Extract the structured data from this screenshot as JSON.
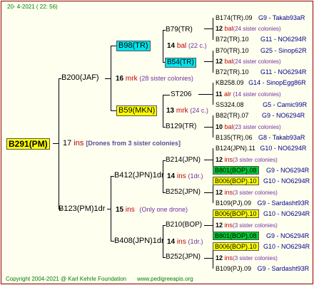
{
  "header": {
    "date": "20-  4-2021 ( 22: 56)"
  },
  "root": {
    "name": "B291(PM)",
    "num": "17",
    "mark": "ins",
    "note": "[Drones from 3 sister colonies]"
  },
  "gen1": {
    "top": {
      "name": "B200(JAF)",
      "num": "16",
      "mark": "mrk",
      "note": "(28 sister colonies)"
    },
    "bottom": {
      "name": "B123(PM)1dr",
      "num": "15",
      "mark": "ins",
      "note": "(Only one drone)"
    }
  },
  "gen2": {
    "a": {
      "name": "B98(TR)",
      "num": "14",
      "mark": "bal",
      "note": "(22 c.)"
    },
    "b": {
      "name": "B59(MKN)",
      "num": "13",
      "mark": "mrk",
      "note": "(24 c.)"
    },
    "c": {
      "name": "B412(JPN)1dr",
      "num": "14",
      "mark": "ins",
      "note": "(1dr.)"
    },
    "d": {
      "name": "B408(JPN)1dr",
      "num": "14",
      "mark": "ins",
      "note": "(1dr.)"
    }
  },
  "gen3": {
    "a1": "B79(TR)",
    "a2": "B54(TR)",
    "b1": "ST206",
    "b2": "B129(TR)",
    "c1": "B214(JPN)",
    "c2": "B252(JPN)",
    "d1": "B210(BOP)",
    "d2": "B252(JPN)"
  },
  "gen4": {
    "r1": {
      "name": "B174(TR).09",
      "code": "G9 - Takab93aR"
    },
    "r2": {
      "num": "12",
      "mark": "bal",
      "note": "(24 sister colonies)"
    },
    "r3": {
      "name": "B72(TR).10",
      "code": "G11 - NO6294R"
    },
    "r4": {
      "name": "B70(TR).10",
      "code": "G25 - Sinop62R"
    },
    "r5": {
      "num": "12",
      "mark": "bal",
      "note": "(24 sister colonies)"
    },
    "r6": {
      "name": "B72(TR).10",
      "code": "G11 - NO6294R"
    },
    "r7": {
      "name": "KB258.09",
      "code": "G14 - SinopEgg86R"
    },
    "r8": {
      "num": "11",
      "mark": "alr",
      "note": "(14 sister colonies)"
    },
    "r9": {
      "name": "SS324.08",
      "code": "G5 - Camic99R"
    },
    "r10": {
      "name": "B82(TR).07",
      "code": "G9 - NO6294R"
    },
    "r11": {
      "num": "10",
      "mark": "bal",
      "note": "(23 sister colonies)"
    },
    "r12": {
      "name": "B135(TR).06",
      "code": "G8 - Takab93aR"
    },
    "r13": {
      "name": "B124(JPN).11",
      "code": "G10 - NO6294R"
    },
    "r14": {
      "num": "12",
      "mark": "ins",
      "note": "(3 sister colonies)"
    },
    "r15": {
      "name": "B801(BOP).08",
      "code": "G9 - NO6294R"
    },
    "r16": {
      "name": "B006(BOP).10",
      "code": "G10 - NO6294R"
    },
    "r17": {
      "num": "12",
      "mark": "ins",
      "note": "(3 sister colonies)"
    },
    "r18": {
      "name": "B109(PJ).09",
      "code": "G9 - Sardasht93R"
    },
    "r19": {
      "name": "B006(BOP).10",
      "code": "G10 - NO6294R"
    },
    "r20": {
      "num": "12",
      "mark": "ins",
      "note": "(3 sister colonies)"
    },
    "r21": {
      "name": "B801(BOP).08",
      "code": "G9 - NO6294R"
    },
    "r22": {
      "name": "B006(BOP).10",
      "code": "G10 - NO6294R"
    },
    "r23": {
      "num": "12",
      "mark": "ins",
      "note": "(3 sister colonies)"
    },
    "r24": {
      "name": "B109(PJ).09",
      "code": "G9 - Sardasht93R"
    }
  },
  "footer": {
    "copyright": "Copyright 2004-2021 @ Karl Kehrle Foundation",
    "site": "www.pedigreeapis.org"
  }
}
